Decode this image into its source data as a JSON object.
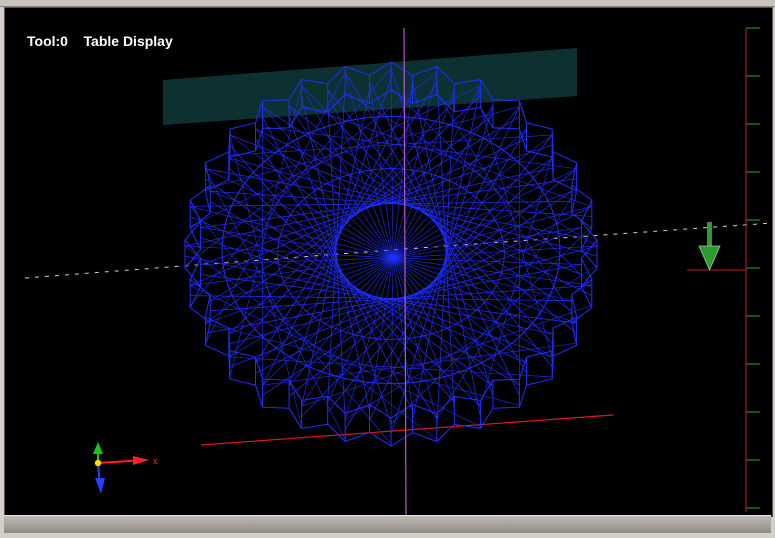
{
  "viewport": {
    "tool_label": "Tool:0",
    "mode_label": "Table Display"
  },
  "colors": {
    "background": "#000000",
    "toolpath": "#1f2fff",
    "table_plane": "#0f3a38",
    "z_axis_line": "#b05cc8",
    "x_axis_line": "#e01818",
    "ruler": "#c81818",
    "ruler_ticks": "#2fa82f",
    "tool_arrow": "#2f9a2f"
  },
  "icons": {
    "axis_triad": "xyz-axis-triad-icon",
    "tool_marker": "down-arrow-tool-icon"
  }
}
